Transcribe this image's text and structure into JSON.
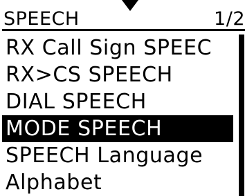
{
  "header": {
    "title": "SPEECH",
    "page": "1/2"
  },
  "menu": {
    "items": [
      {
        "label": "RX Call Sign SPEEC"
      },
      {
        "label": "RX>CS SPEECH"
      },
      {
        "label": "DIAL SPEECH"
      },
      {
        "label": "MODE SPEECH"
      },
      {
        "label": "SPEECH Language"
      },
      {
        "label": "Alphabet"
      }
    ],
    "selected_label": "MODE SPEECH"
  },
  "colors": {
    "background": "#ffffff",
    "foreground": "#000000",
    "highlight_background": "#000000",
    "highlight_text": "#ffffff"
  },
  "icons": {
    "pointer": "down-triangle-icon"
  }
}
